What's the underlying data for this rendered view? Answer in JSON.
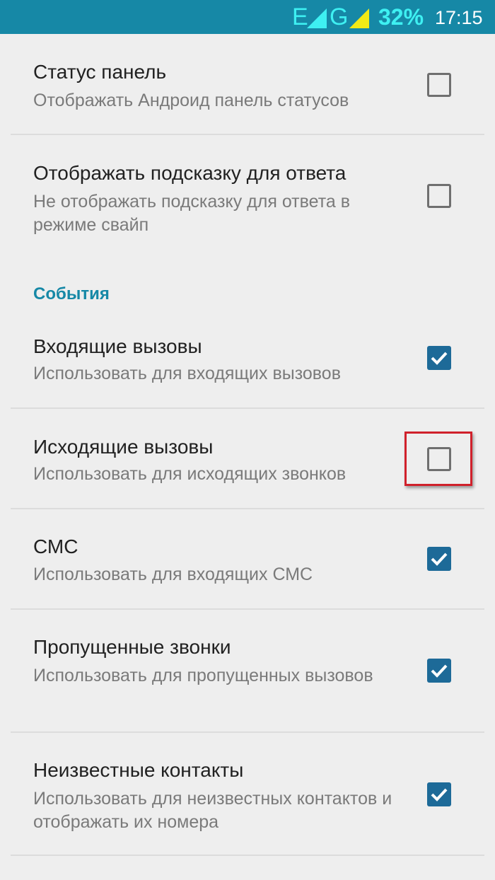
{
  "status_bar": {
    "network_1": "E",
    "network_2": "G",
    "battery": "32%",
    "time": "17:15",
    "signal_icon_color": "#f2ea16",
    "network_color": "#3ef0f2",
    "background": "#1688a6"
  },
  "prefs": {
    "status_bar": {
      "title": "Статус панель",
      "summary": "Отображать Андроид панель статусов",
      "checked": false
    },
    "answer_hint": {
      "title": "Отображать подсказку для ответа",
      "summary": "Не отображать подсказку для ответа в режиме свайп",
      "checked": false
    }
  },
  "events_section": {
    "header": "События",
    "items": [
      {
        "title": "Входящие вызовы",
        "summary": "Использовать для входящих вызовов",
        "checked": true
      },
      {
        "title": "Исходящие вызовы",
        "summary": "Использовать для исходящих звонков",
        "checked": false,
        "highlighted": true
      },
      {
        "title": "СМС",
        "summary": "Использовать для входящих СМС",
        "checked": true
      },
      {
        "title": "Пропущенные звонки",
        "summary": "Использовать для пропущенных вызовов",
        "checked": true
      },
      {
        "title": "Неизвестные контакты",
        "summary": "Использовать для неизвестных контактов и отображать их номера",
        "checked": true
      }
    ]
  },
  "colors": {
    "accent": "#1688a6",
    "checkbox_checked": "#1d6a98",
    "highlight_border": "#d0212b"
  }
}
